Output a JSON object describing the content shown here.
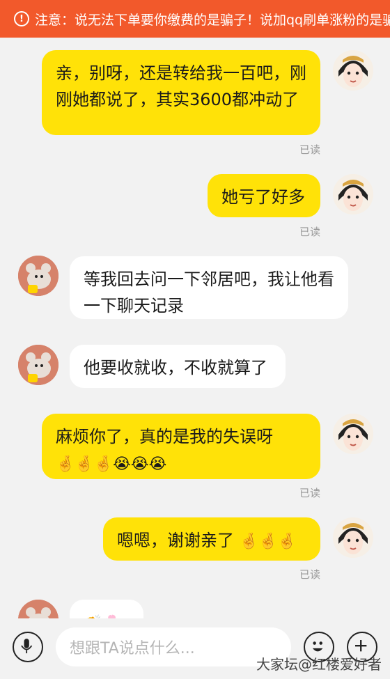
{
  "banner": {
    "icon": "alert-circle-icon",
    "text": "注意：说无法下单要你缴费的是骗子！说加qq刷单涨粉的是骗"
  },
  "colors": {
    "banner": "#f2592b",
    "my_bubble": "#ffe208",
    "their_bubble": "#ffffff",
    "background": "#f2f2f2"
  },
  "messages": [
    {
      "sender": "me",
      "text": "亲，别呀，还是转给我一百吧，刚刚她都说了，其实3600都冲动了",
      "status": "已读"
    },
    {
      "sender": "me",
      "text": "她亏了好多",
      "status": "已读"
    },
    {
      "sender": "other",
      "text": "等我回去问一下邻居吧，我让他看一下聊天记录"
    },
    {
      "sender": "other",
      "text": "他要收就收，不收就算了"
    },
    {
      "sender": "me",
      "text": "麻烦你了，真的是我的失误呀",
      "emojis": "🤞🤞🤞😭😭😭",
      "status": "已读"
    },
    {
      "sender": "me",
      "text": "嗯嗯，谢谢亲了",
      "emojis": "🤞🤞🤞",
      "status": "已读"
    },
    {
      "sender": "other",
      "emojis": "👏🌸"
    }
  ],
  "composer": {
    "placeholder": "想跟TA说点什么...",
    "mic_icon": "microphone-icon",
    "emoji_icon": "smiley-icon",
    "plus_icon": "plus-icon"
  },
  "watermark": "大家坛@红楼爱好者"
}
